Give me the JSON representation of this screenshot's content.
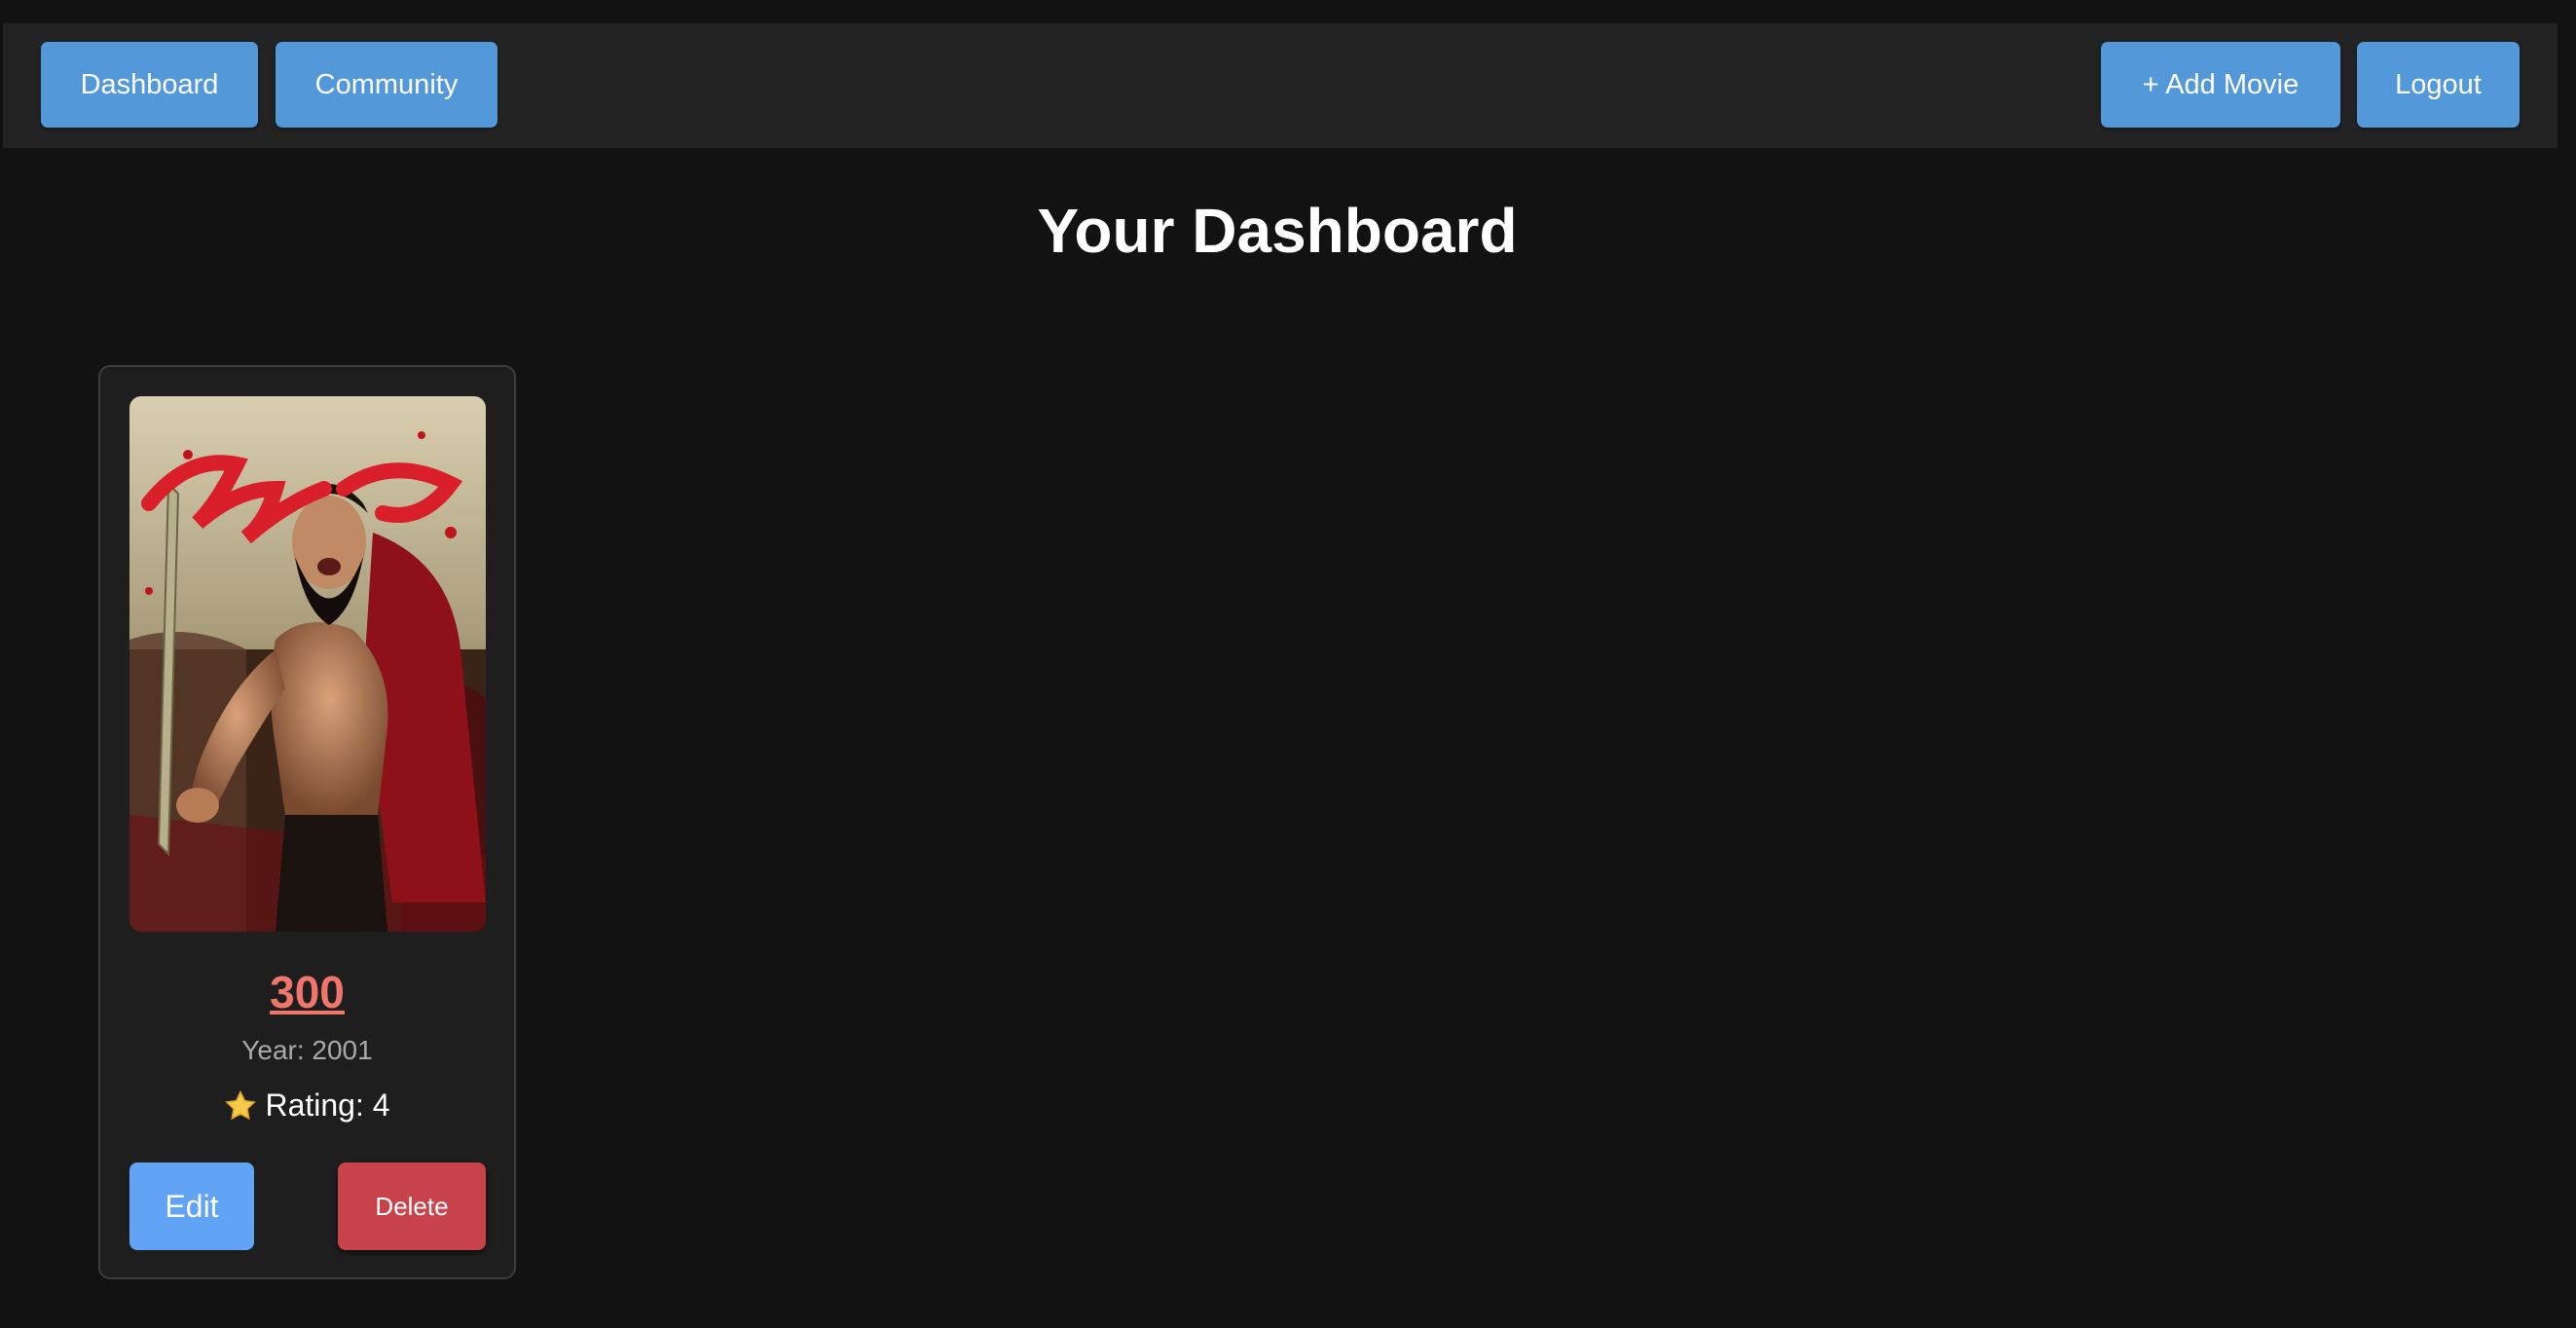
{
  "nav": {
    "dashboard_label": "Dashboard",
    "community_label": "Community",
    "add_movie_label": "+ Add Movie",
    "logout_label": "Logout"
  },
  "page": {
    "title": "Your Dashboard"
  },
  "movies": [
    {
      "title": "300",
      "year_text": "Year: 2001",
      "rating_text": "Rating: 4",
      "poster_text": "300",
      "edit_label": "Edit",
      "delete_label": "Delete"
    }
  ],
  "colors": {
    "background": "#121212",
    "navbar": "#232323",
    "primary_button": "#5398d9",
    "edit_button": "#61a3f5",
    "delete_button": "#c9434d",
    "movie_title": "#f0766b"
  },
  "icons": {
    "rating": "star-icon"
  }
}
